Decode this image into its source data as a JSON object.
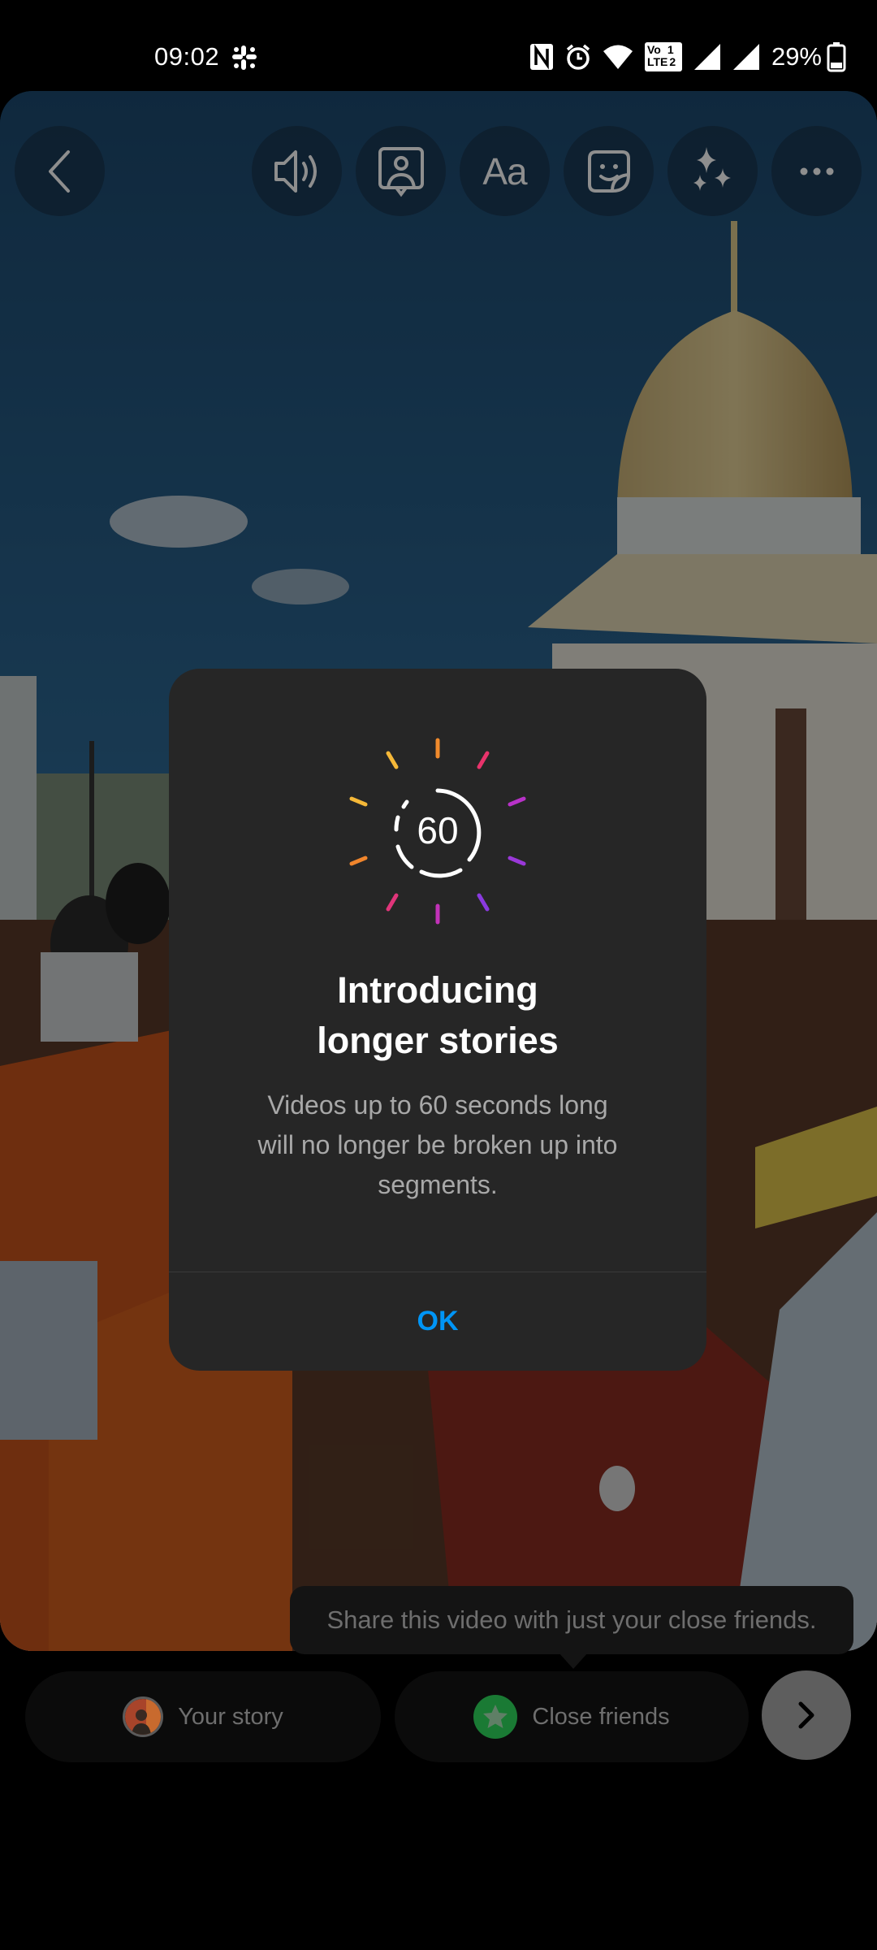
{
  "status_bar": {
    "time": "09:02",
    "battery_percent": "29%",
    "icons": [
      "slack-icon",
      "nfc-icon",
      "alarm-icon",
      "wifi-icon",
      "volte-icon",
      "signal-sim1-icon",
      "signal-sim2-icon",
      "battery-icon"
    ],
    "volte_line1": "Vo",
    "volte_line2": "LTE",
    "sim_1": "1",
    "sim_2": "2"
  },
  "toolbar": {
    "back": "back-icon",
    "buttons": [
      "sound-icon",
      "mention-icon",
      "text-icon",
      "sticker-icon",
      "effects-icon",
      "more-icon"
    ],
    "text_tool_label": "Aa"
  },
  "dialog": {
    "badge_number": "60",
    "title_line1": "Introducing",
    "title_line2": "longer stories",
    "body_line1": "Videos up to 60 seconds long",
    "body_line2": "will no longer be broken up into",
    "body_line3": "segments.",
    "ok_label": "OK",
    "colors": {
      "ok": "#0095f6",
      "background": "#262626"
    }
  },
  "tooltip": {
    "text": "Share this video with just your close friends."
  },
  "share_bar": {
    "your_story_label": "Your story",
    "close_friends_label": "Close friends",
    "next": "chevron-right-icon",
    "colors": {
      "close_friends": "#1a7a34"
    }
  }
}
